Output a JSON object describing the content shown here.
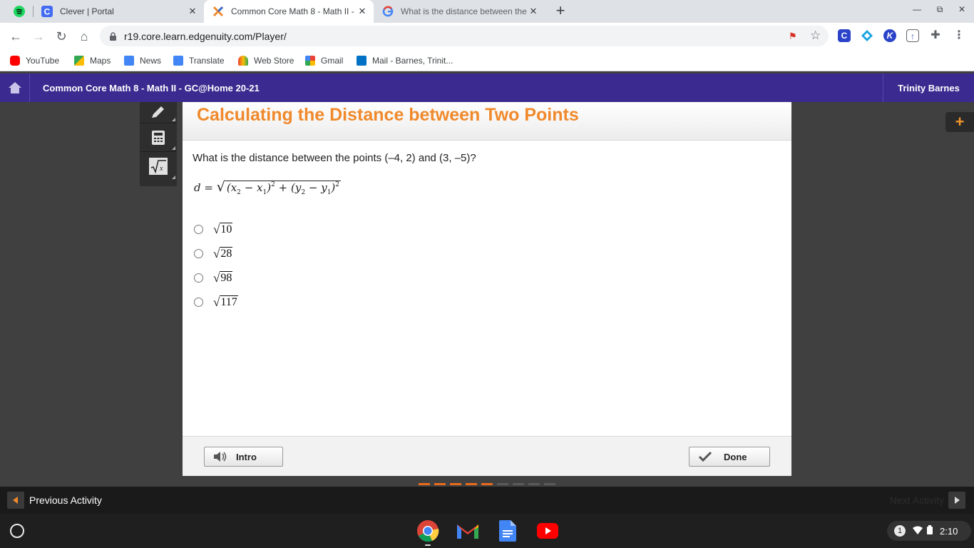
{
  "browser": {
    "tabs": [
      {
        "title": "Clever | Portal",
        "icon": "clever-icon",
        "active": false
      },
      {
        "title": "Common Core Math 8 - Math II -",
        "icon": "edgenuity-icon",
        "active": true
      },
      {
        "title": "What is the distance between the",
        "icon": "google-icon",
        "active": false
      }
    ],
    "url": "r19.core.learn.edgenuity.com/Player/",
    "bookmarks": [
      {
        "label": "YouTube",
        "icon": "youtube-icon",
        "color": "#ff0000"
      },
      {
        "label": "Maps",
        "icon": "maps-icon",
        "color": "#34a853"
      },
      {
        "label": "News",
        "icon": "news-icon",
        "color": "#4285f4"
      },
      {
        "label": "Translate",
        "icon": "translate-icon",
        "color": "#4285f4"
      },
      {
        "label": "Web Store",
        "icon": "webstore-icon",
        "color": "#ea4335"
      },
      {
        "label": "Gmail",
        "icon": "gmail-icon",
        "color": "#ea4335"
      },
      {
        "label": "Mail - Barnes, Trinit...",
        "icon": "outlook-icon",
        "color": "#0072c6"
      }
    ]
  },
  "header": {
    "course_title": "Common Core Math 8 - Math II - GC@Home 20-21",
    "user_name": "Trinity Barnes"
  },
  "lesson": {
    "title": "Calculating the Distance between Two Points",
    "question": "What is the distance between the points (–4, 2) and (3, –5)?",
    "formula": {
      "lhs": "d =",
      "x2": "x",
      "x2_sub": "2",
      "x1": "x",
      "x1_sub": "1",
      "y2": "y",
      "y2_sub": "2",
      "y1": "y",
      "y1_sub": "1",
      "power": "2",
      "minus": "−",
      "plus": "+",
      "open": "(",
      "close": ")"
    },
    "options": [
      {
        "radicand": "10"
      },
      {
        "radicand": "28"
      },
      {
        "radicand": "98"
      },
      {
        "radicand": "117"
      }
    ],
    "radical": "√"
  },
  "footer": {
    "intro_label": "Intro",
    "done_label": "Done"
  },
  "activity_nav": {
    "prev_label": "Previous Activity",
    "next_label": "Next Activity"
  },
  "progress": {
    "total": 9,
    "completed": 5
  },
  "shelf": {
    "apps": [
      "chrome-icon",
      "gmail-icon",
      "docs-icon",
      "youtube-icon"
    ],
    "notification_count": "1",
    "time": "2:10"
  },
  "colors": {
    "header_purple": "#3b2a8f",
    "title_orange": "#f0892b"
  }
}
